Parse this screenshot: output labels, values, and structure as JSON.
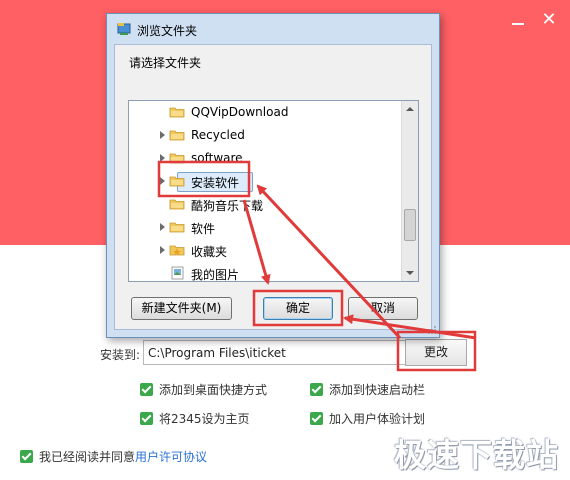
{
  "installer": {
    "minimize_label": "—",
    "close_label": "✕",
    "install_to_label": "安装到:",
    "path_value": "C:\\Program Files\\iticket",
    "change_button": "更改",
    "options": [
      {
        "label": "添加到桌面快捷方式",
        "checked": true
      },
      {
        "label": "添加到快速启动栏",
        "checked": true
      },
      {
        "label": "将2345设为主页",
        "checked": true
      },
      {
        "label": "加入用户体验计划",
        "checked": true
      }
    ],
    "agree_text": "我已经阅读并同意",
    "agree_link": "用户许可协议",
    "header_color": "#ff6064"
  },
  "dialog": {
    "title": "浏览文件夹",
    "prompt": "请选择文件夹",
    "tree_items": [
      {
        "label": "QQVipDownload",
        "expandable": false,
        "icon": "folder-icon"
      },
      {
        "label": "Recycled",
        "expandable": true,
        "icon": "folder-icon"
      },
      {
        "label": "software",
        "expandable": true,
        "icon": "folder-icon"
      },
      {
        "label": "安装软件",
        "expandable": true,
        "icon": "folder-icon",
        "selected": true
      },
      {
        "label": "酷狗音乐下载",
        "expandable": false,
        "icon": "folder-icon"
      },
      {
        "label": "软件",
        "expandable": true,
        "icon": "folder-icon"
      },
      {
        "label": "收藏夹",
        "expandable": true,
        "icon": "star-folder-icon"
      },
      {
        "label": "我的图片",
        "expandable": false,
        "icon": "pictures-folder-icon"
      }
    ],
    "new_folder_button": "新建文件夹(M)",
    "ok_button": "确定",
    "cancel_button": "取消"
  },
  "watermark": "极速下载站",
  "annotation_color": "#e03a3a"
}
